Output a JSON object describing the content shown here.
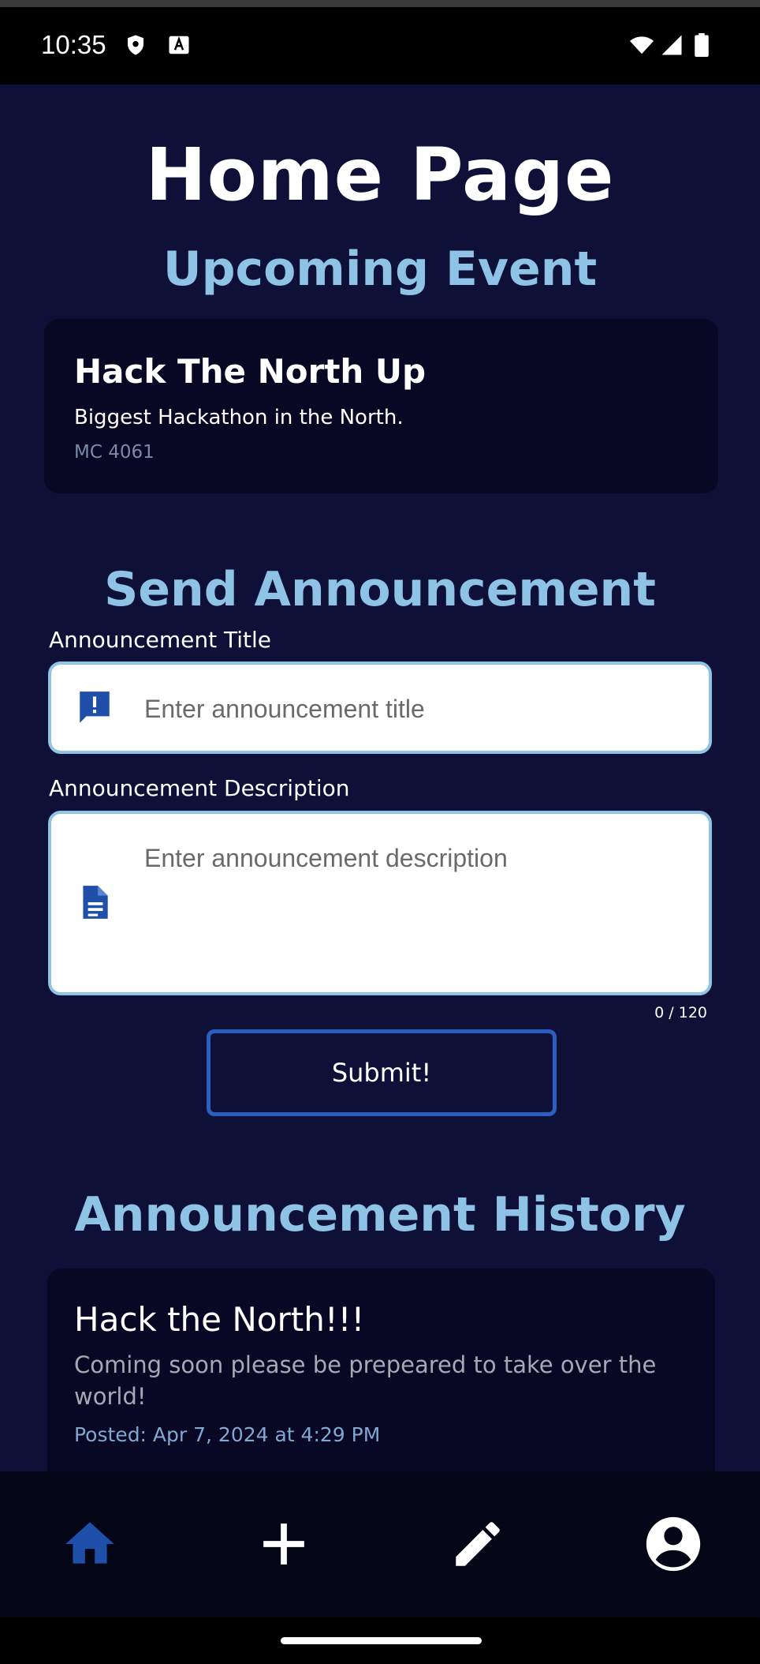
{
  "status_bar": {
    "time": "10:35"
  },
  "page": {
    "title": "Home Page"
  },
  "upcoming": {
    "heading": "Upcoming Event",
    "event": {
      "title": "Hack The North Up",
      "description": "Biggest Hackathon in the North.",
      "location": "MC 4061"
    }
  },
  "send": {
    "heading": "Send Announcement",
    "title_label": "Announcement Title",
    "title_placeholder": "Enter announcement title",
    "title_value": "",
    "desc_label": "Announcement Description",
    "desc_placeholder": "Enter announcement description",
    "desc_value": "",
    "char_counter": "0 / 120",
    "submit_label": "Submit!"
  },
  "history": {
    "heading": "Announcement History",
    "items": [
      {
        "title": "Hack the North!!!",
        "body": "Coming soon please be prepeared to take over the world!",
        "posted": "Posted: Apr 7, 2024 at 4:29 PM"
      }
    ]
  },
  "nav": {
    "items": [
      {
        "name": "home",
        "icon": "home-icon",
        "active": true
      },
      {
        "name": "add",
        "icon": "plus-icon",
        "active": false
      },
      {
        "name": "edit",
        "icon": "pencil-icon",
        "active": false
      },
      {
        "name": "profile",
        "icon": "account-circle-icon",
        "active": false
      }
    ]
  },
  "colors": {
    "background": "#0f1038",
    "card": "#080825",
    "accent_light": "#8ec3e6",
    "accent_blue": "#1f4fa8",
    "nav_active": "#1f4fa8"
  }
}
